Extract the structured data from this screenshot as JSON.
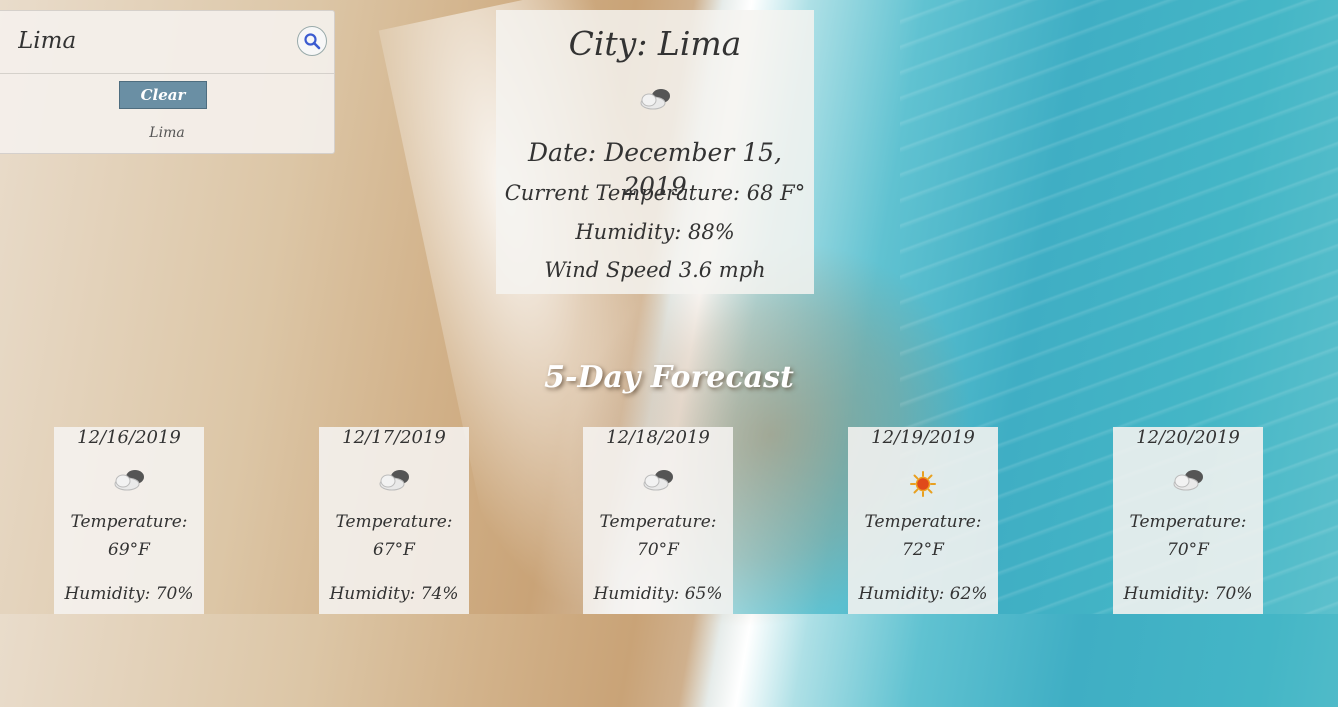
{
  "search": {
    "value": "Lima",
    "clear_label": "Clear",
    "history": [
      "Lima"
    ]
  },
  "current": {
    "city": "City: Lima",
    "icon": "cloudy-icon",
    "date": "Date: December 15, 2019",
    "temperature": "Current Temperature: 68 F°",
    "humidity": "Humidity: 88%",
    "wind": "Wind Speed 3.6 mph"
  },
  "forecast": {
    "heading": "5-Day Forecast",
    "temp_label": "Temperature:",
    "days": [
      {
        "date": "12/16/2019",
        "icon": "cloudy-icon",
        "temp": "69°F",
        "humidity": "Humidity: 70%"
      },
      {
        "date": "12/17/2019",
        "icon": "cloudy-icon",
        "temp": "67°F",
        "humidity": "Humidity: 74%"
      },
      {
        "date": "12/18/2019",
        "icon": "cloudy-icon",
        "temp": "70°F",
        "humidity": "Humidity: 65%"
      },
      {
        "date": "12/19/2019",
        "icon": "sun-icon",
        "temp": "72°F",
        "humidity": "Humidity: 62%"
      },
      {
        "date": "12/20/2019",
        "icon": "cloudy-icon",
        "temp": "70°F",
        "humidity": "Humidity: 70%"
      }
    ]
  },
  "colors": {
    "clear_button": "#6a8fa4",
    "sun": "#e04a1a"
  }
}
